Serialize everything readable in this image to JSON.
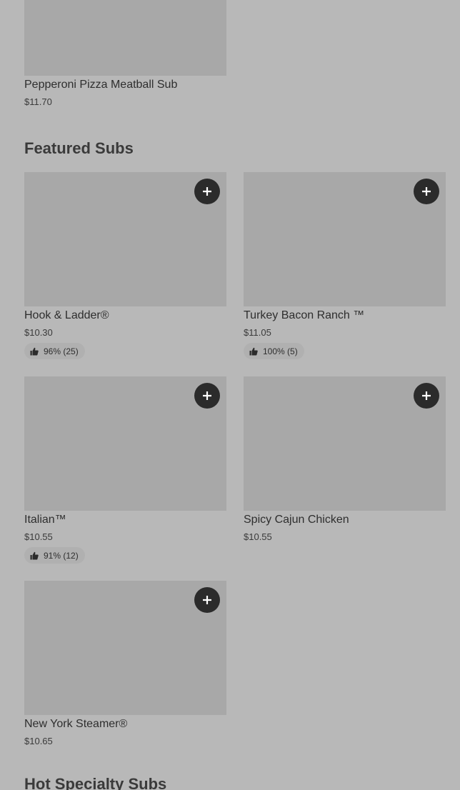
{
  "top_item": {
    "name": "Pepperoni Pizza Meatball Sub",
    "price": "$11.70"
  },
  "featured": {
    "title": "Featured Subs",
    "items": [
      {
        "name": "Hook & Ladder®",
        "price": "$10.30",
        "rating": "96% (25)"
      },
      {
        "name": "Turkey Bacon Ranch ™",
        "price": "$11.05",
        "rating": "100% (5)"
      },
      {
        "name": "Italian™",
        "price": "$10.55",
        "rating": "91% (12)"
      },
      {
        "name": "Spicy Cajun Chicken",
        "price": "$10.55"
      },
      {
        "name": "New York Steamer®",
        "price": "$10.65"
      }
    ]
  },
  "next_section": {
    "title": "Hot Specialty Subs"
  },
  "icons": {
    "add": "plus-icon",
    "rating": "thumbs-up-icon"
  },
  "colors": {
    "background": "#b8b8b8",
    "image_placeholder": "#a8a8a8",
    "add_button": "#2b2b2b"
  }
}
